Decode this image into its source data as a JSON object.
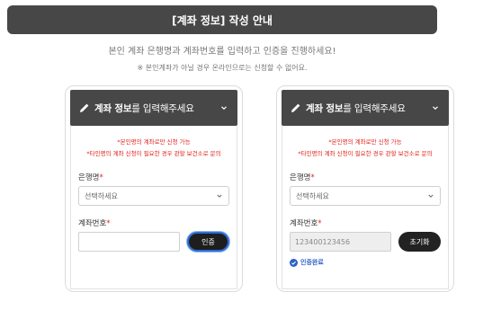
{
  "banner": {
    "title": "[계좌 정보] 작성 안내"
  },
  "intro": {
    "main": "본인 계좌 은행명과 계좌번호를 입력하고 인증을 진행하세요!",
    "note": "※ 본인계좌가 아닐 경우 온라인으로는 신청할 수 없어요."
  },
  "cards": [
    {
      "title_bold": "계좌 정보",
      "title_rest": "를 입력해주세요",
      "warn1": "*본인명의 계좌로만 신청 가능",
      "warn2": "*타인명의 계좌 신청이 필요한 경우 관할 보건소로 문의",
      "bank_label": "은행명",
      "bank_value": "선택하세요",
      "account_label": "계좌번호",
      "account_value": "",
      "button_label": "인증"
    },
    {
      "title_bold": "계좌 정보",
      "title_rest": "를 입력해주세요",
      "warn1": "*본인명의 계좌로만 신청 가능",
      "warn2": "*타인명의 계좌 신청이 필요한 경우 관할 보건소로 문의",
      "bank_label": "은행명",
      "bank_value": "선택하세요",
      "account_label": "계좌번호",
      "account_value": "123400123456",
      "button_label": "초기화",
      "status": "인증완료"
    }
  ],
  "required_mark": "*",
  "colors": {
    "header": "#474747",
    "required": "#e0231c",
    "verified": "#2b62c4",
    "focus_ring": "#2b6fd6"
  },
  "icons": {
    "edit": "pencil-icon",
    "collapse": "chevron-down-icon",
    "status": "check-circle-icon"
  }
}
